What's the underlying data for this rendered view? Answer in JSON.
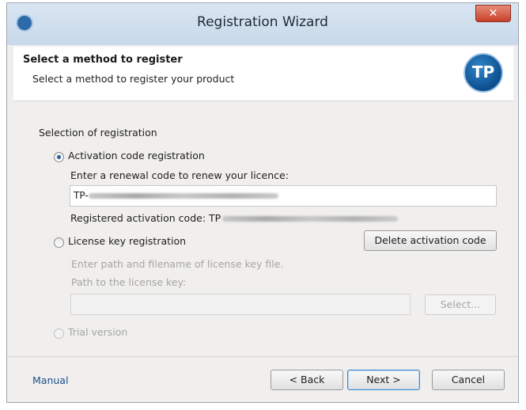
{
  "window": {
    "title": "Registration Wizard",
    "close_glyph": "✕",
    "app_icon": "tp-icon",
    "app_icon_text": ""
  },
  "header": {
    "title": "Select a method to register",
    "subtitle": "Select a method to register your product",
    "logo_icon": "tp-logo-icon",
    "logo_text": "TP"
  },
  "selection": {
    "group_label": "Selection of registration",
    "activation": {
      "label": "Activation code registration",
      "selected": true,
      "renew_prompt": "Enter a renewal code to renew your licence:",
      "code_value_prefix": "TP-",
      "registered_prefix": "Registered activation code: TP"
    },
    "license_key": {
      "label": "License key registration",
      "selected": false,
      "path_prompt": "Enter path and filename of license key file.",
      "path_label": "Path to the license key:",
      "path_value": "",
      "select_button": "Select..."
    },
    "trial": {
      "label": "Trial version",
      "selected": false
    },
    "delete_button": "Delete activation code"
  },
  "footer": {
    "manual_link": "Manual",
    "back_button": "< Back",
    "next_button": "Next >",
    "cancel_button": "Cancel"
  }
}
